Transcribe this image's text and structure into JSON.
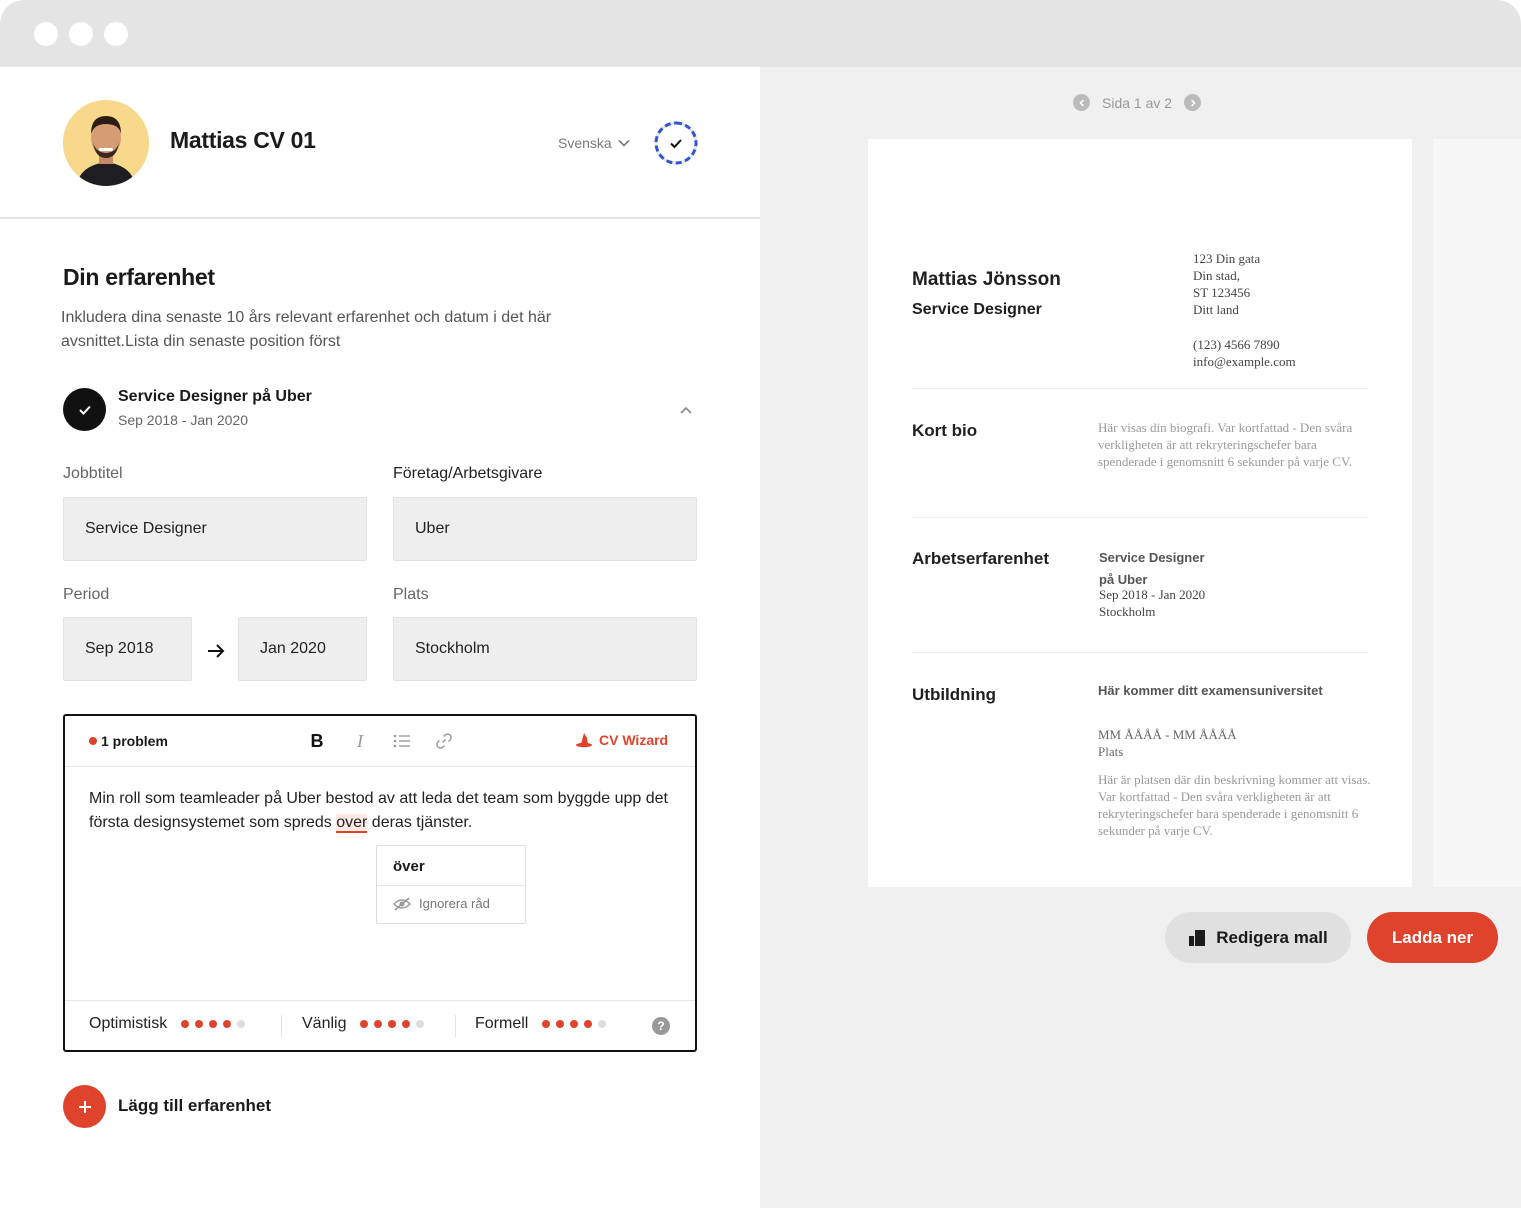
{
  "header": {
    "cv_title": "Mattias CV 01",
    "language": "Svenska"
  },
  "section": {
    "title": "Din erfarenhet",
    "description": "Inkludera dina senaste 10 års relevant erfarenhet och datum i det här avsnittet.Lista din senaste position först"
  },
  "experience": {
    "title": "Service Designer på Uber",
    "dates": "Sep 2018 - Jan 2020",
    "job_title_label": "Jobbtitel",
    "job_title_value": "Service Designer",
    "employer_label": "Företag/Arbetsgivare",
    "employer_value": "Uber",
    "period_label": "Period",
    "period_start": "Sep 2018",
    "period_end": "Jan 2020",
    "location_label": "Plats",
    "location_value": "Stockholm"
  },
  "editor": {
    "problem_count": "1 problem",
    "bold_label": "B",
    "italic_label": "I",
    "wizard_label": "CV Wizard",
    "text_before": "Min roll som teamleader på Uber bestod av att leda det team som byggde upp det första designsystemet som spreds ",
    "text_misspelled": "over",
    "text_after": " deras tjänster.",
    "suggestion": "över",
    "ignore_label": "Ignorera råd",
    "tones": [
      {
        "label": "Optimistisk",
        "level": 4,
        "max": 5
      },
      {
        "label": "Vänlig",
        "level": 4,
        "max": 5
      },
      {
        "label": "Formell",
        "level": 4,
        "max": 5
      }
    ],
    "help_label": "?"
  },
  "add_experience_label": "Lägg till erfarenhet",
  "preview": {
    "pager": "Sida 1 av 2",
    "name": "Mattias Jönsson",
    "role": "Service Designer",
    "address_lines": [
      "123 Din gata",
      "Din stad,",
      "ST 123456",
      "Ditt land"
    ],
    "phone": "(123) 4566 7890",
    "email": "info@example.com",
    "bio_heading": "Kort bio",
    "bio_text": "Här visas din biografi. Var kortfattad - Den svåra verkligheten är att rekryteringschefer bara spenderade i genomsnitt 6 sekunder på varje CV.",
    "work_heading": "Arbetserfarenhet",
    "work_title_line1": "Service Designer",
    "work_title_line2": "på Uber",
    "work_dates": "Sep 2018 - Jan 2020",
    "work_location": "Stockholm",
    "edu_heading": "Utbildning",
    "edu_school": "Här kommer ditt examensuniversitet",
    "edu_dates": "MM ÅÅÅÅ - MM ÅÅÅÅ",
    "edu_location": "Plats",
    "edu_text": "Här är platsen där din beskrivning kommer att visas. Var kortfattad - Den svåra verkligheten är att rekryteringschefer bara spenderade i genomsnitt 6 sekunder på varje CV."
  },
  "actions": {
    "edit_template": "Redigera mall",
    "download": "Ladda ner"
  },
  "colors": {
    "accent": "#e0432b",
    "progress_ring": "#2f55d4",
    "avatar_bg": "#f8d98b"
  }
}
